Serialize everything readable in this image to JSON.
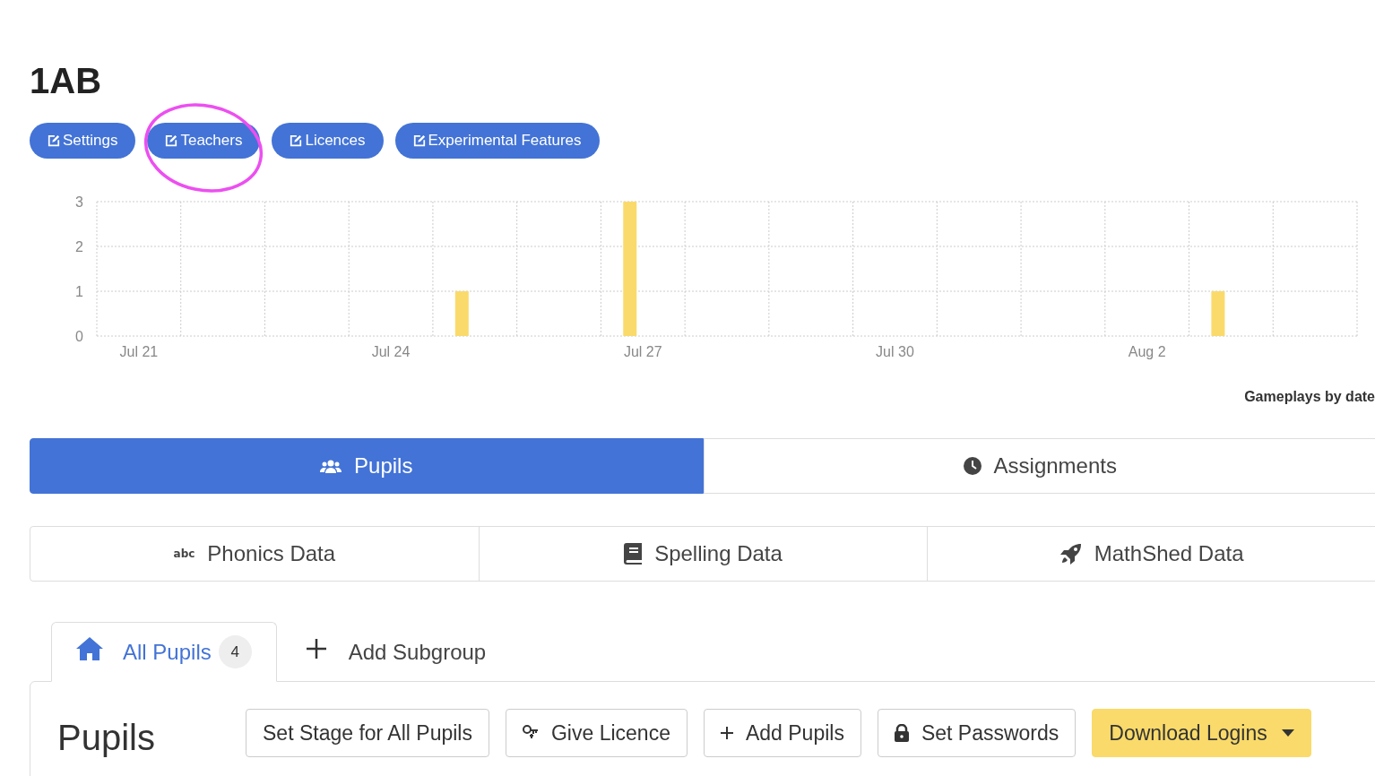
{
  "title": "1AB",
  "buttons": [
    {
      "label": "Settings",
      "annotated": false
    },
    {
      "label": "Teachers",
      "annotated": true
    },
    {
      "label": "Licences",
      "annotated": false
    },
    {
      "label": "Experimental Features",
      "annotated": false
    }
  ],
  "chart_data": {
    "type": "bar",
    "title": "Gameplays by date",
    "categories": [
      "Jul 21",
      null,
      null,
      "Jul 24",
      null,
      null,
      "Jul 27",
      null,
      null,
      "Jul 30",
      null,
      null,
      "Aug 2",
      null,
      null
    ],
    "values": [
      0,
      0,
      0,
      0,
      1,
      0,
      3,
      0,
      0,
      0,
      0,
      0,
      0,
      1,
      0
    ],
    "ylim": [
      0,
      3
    ],
    "yticks": [
      0,
      1,
      2,
      3
    ]
  },
  "main_tabs": [
    {
      "label": "Pupils",
      "selected": true
    },
    {
      "label": "Assignments",
      "selected": false
    }
  ],
  "data_tabs": [
    {
      "label": "Phonics Data",
      "icon_text": "abc"
    },
    {
      "label": "Spelling Data"
    },
    {
      "label": "MathShed Data"
    }
  ],
  "group_tabs": [
    {
      "kind": "group",
      "label": "All Pupils",
      "count": "4",
      "selected": true
    },
    {
      "kind": "add",
      "label": "Add Subgroup",
      "selected": false
    }
  ],
  "panel": {
    "heading": "Pupils",
    "actions": [
      {
        "label": "Set Stage for All Pupils",
        "kind": "plain"
      },
      {
        "label": "Give Licence",
        "kind": "plain"
      },
      {
        "label": "Add Pupils",
        "kind": "plain"
      },
      {
        "label": "Set Passwords",
        "kind": "plain"
      },
      {
        "label": "Download Logins",
        "kind": "dropdown"
      }
    ]
  }
}
